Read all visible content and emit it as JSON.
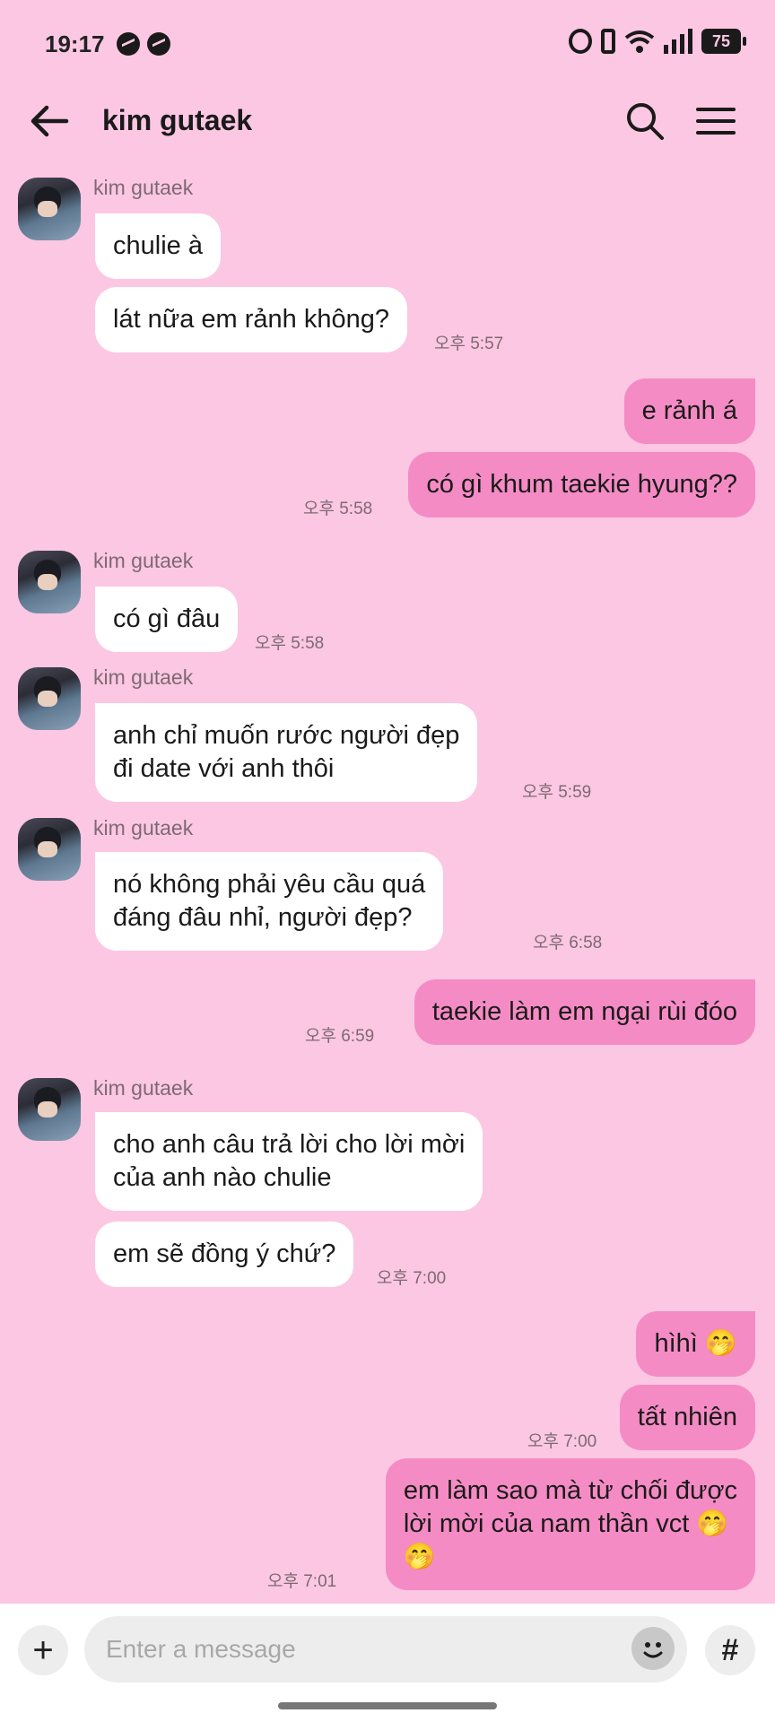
{
  "status_bar": {
    "time": "19:17",
    "battery": "75"
  },
  "header": {
    "title": "kim gutaek"
  },
  "messages": [
    {
      "sender": "kim gutaek",
      "text": "chulie à"
    },
    {
      "text": "lát nữa em rảnh không?",
      "time": "오후 5:57"
    },
    {
      "text": "e rảnh á"
    },
    {
      "text": "có gì khum taekie hyung??",
      "time": "오후 5:58"
    },
    {
      "sender": "kim gutaek",
      "text": "có gì đâu",
      "time": "오후 5:58"
    },
    {
      "sender": "kim gutaek",
      "text_lines": [
        "anh chỉ muốn rước người đẹp",
        "đi date với anh thôi"
      ],
      "time": "오후 5:59"
    },
    {
      "sender": "kim gutaek",
      "text_lines": [
        "nó không phải yêu cầu quá",
        "đáng đâu nhỉ, người đẹp?"
      ],
      "time": "오후 6:58"
    },
    {
      "text": "taekie làm em ngại rùi đóo",
      "time": "오후 6:59"
    },
    {
      "sender": "kim gutaek",
      "text_lines": [
        "cho anh câu trả lời cho lời mời",
        "của anh nào chulie"
      ]
    },
    {
      "text": "em sẽ đồng ý chứ?",
      "time": "오후 7:00"
    },
    {
      "text": "hìhì 🤭"
    },
    {
      "text": "tất nhiên",
      "time": "오후 7:00"
    },
    {
      "text_lines": [
        "em làm sao mà từ chối được",
        "lời mời của nam thần vct 🤭",
        "🤭"
      ],
      "time": "오후 7:01"
    }
  ],
  "input": {
    "placeholder": "Enter a message"
  },
  "colors": {
    "background": "#fcc7e3",
    "outgoing_bubble": "#f58bc4",
    "incoming_bubble": "#ffffff"
  }
}
